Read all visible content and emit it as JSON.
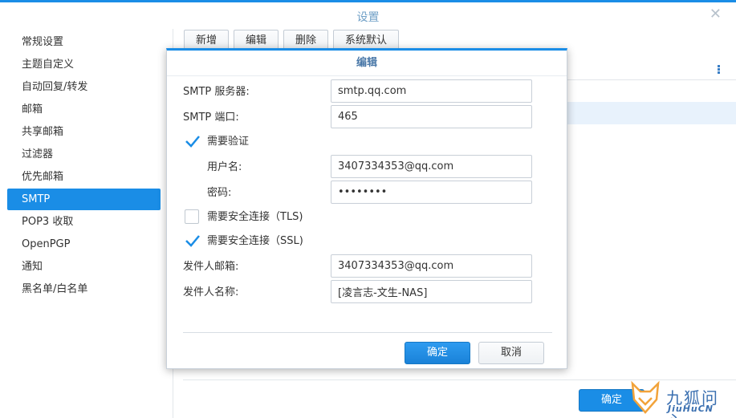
{
  "window": {
    "title": "设置",
    "close_glyph": "✕"
  },
  "sidebar": {
    "items": [
      {
        "label": "常规设置",
        "active": false
      },
      {
        "label": "主题自定义",
        "active": false
      },
      {
        "label": "自动回复/转发",
        "active": false
      },
      {
        "label": "邮箱",
        "active": false
      },
      {
        "label": "共享邮箱",
        "active": false
      },
      {
        "label": "过滤器",
        "active": false
      },
      {
        "label": "优先邮箱",
        "active": false
      },
      {
        "label": "SMTP",
        "active": true
      },
      {
        "label": "POP3 收取",
        "active": false
      },
      {
        "label": "OpenPGP",
        "active": false
      },
      {
        "label": "通知",
        "active": false
      },
      {
        "label": "黑名单/白名单",
        "active": false
      }
    ]
  },
  "toolbar": {
    "new_label": "新增",
    "edit_label": "编辑",
    "delete_label": "删除",
    "default_label": "系统默认"
  },
  "background": {
    "ok_label": "确定"
  },
  "dialog": {
    "title": "编辑",
    "smtp_server_label": "SMTP 服务器:",
    "smtp_server_value": "smtp.qq.com",
    "smtp_port_label": "SMTP 端口:",
    "smtp_port_value": "465",
    "require_auth_label": "需要验证",
    "require_auth_checked": true,
    "username_label": "用户名:",
    "username_value": "3407334353@qq.com",
    "password_label": "密码:",
    "password_value": "••••••••",
    "tls_label": "需要安全连接（TLS)",
    "tls_checked": false,
    "ssl_label": "需要安全连接（SSL)",
    "ssl_checked": true,
    "sender_email_label": "发件人邮箱:",
    "sender_email_value": "3407334353@qq.com",
    "sender_name_label": "发件人名称:",
    "sender_name_value": "[凌言志-文生-NAS]",
    "ok_label": "确定",
    "cancel_label": "取消"
  },
  "watermark": {
    "cn": "九狐问心",
    "en": "JiuHuCN"
  },
  "colors": {
    "accent": "#1a8de6",
    "checkmark": "#1a8de6",
    "title_text": "#6f9fc6"
  }
}
